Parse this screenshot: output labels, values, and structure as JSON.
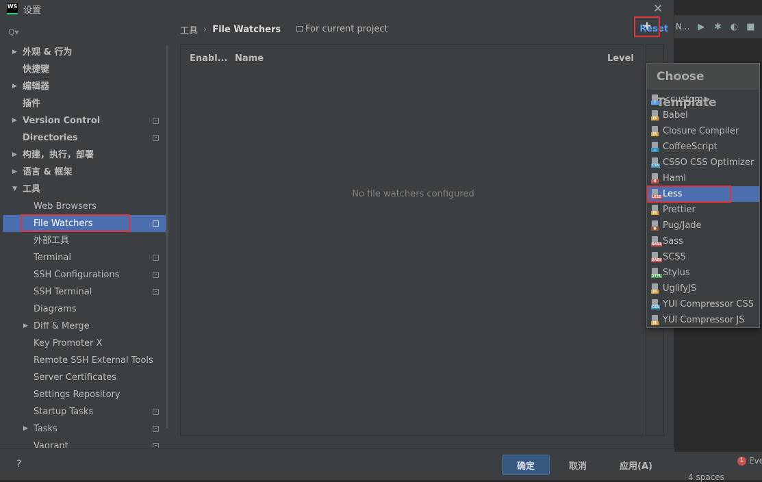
{
  "window": {
    "title": "设置",
    "logo_text": "WS"
  },
  "ide": {
    "toolbar_text": "N...",
    "status_events": "Eve",
    "status_events_count": "1",
    "status_spaces": "4 spaces"
  },
  "sidebar": {
    "search_placeholder": "Q▾",
    "items": [
      {
        "label": "外观 & 行为",
        "arrow": "▶",
        "bold": true,
        "child": false,
        "copy": false
      },
      {
        "label": "快捷键",
        "arrow": "",
        "bold": true,
        "child": false,
        "copy": false
      },
      {
        "label": "编辑器",
        "arrow": "▶",
        "bold": true,
        "child": false,
        "copy": false
      },
      {
        "label": "插件",
        "arrow": "",
        "bold": true,
        "child": false,
        "copy": false
      },
      {
        "label": "Version Control",
        "arrow": "▶",
        "bold": true,
        "child": false,
        "copy": true
      },
      {
        "label": "Directories",
        "arrow": "",
        "bold": true,
        "child": false,
        "copy": true
      },
      {
        "label": "构建，执行，部署",
        "arrow": "▶",
        "bold": true,
        "child": false,
        "copy": false
      },
      {
        "label": "语言 & 框架",
        "arrow": "▶",
        "bold": true,
        "child": false,
        "copy": false
      },
      {
        "label": "工具",
        "arrow": "▼",
        "bold": true,
        "child": false,
        "copy": false
      },
      {
        "label": "Web Browsers",
        "arrow": "",
        "bold": false,
        "child": true,
        "copy": false
      },
      {
        "label": "File Watchers",
        "arrow": "",
        "bold": false,
        "child": true,
        "copy": true,
        "selected": true
      },
      {
        "label": "外部工具",
        "arrow": "",
        "bold": false,
        "child": true,
        "copy": false
      },
      {
        "label": "Terminal",
        "arrow": "",
        "bold": false,
        "child": true,
        "copy": true
      },
      {
        "label": "SSH Configurations",
        "arrow": "",
        "bold": false,
        "child": true,
        "copy": true
      },
      {
        "label": "SSH Terminal",
        "arrow": "",
        "bold": false,
        "child": true,
        "copy": true
      },
      {
        "label": "Diagrams",
        "arrow": "",
        "bold": false,
        "child": true,
        "copy": false
      },
      {
        "label": "Diff & Merge",
        "arrow": "▶",
        "bold": false,
        "child": true,
        "copy": false
      },
      {
        "label": "Key Promoter X",
        "arrow": "",
        "bold": false,
        "child": true,
        "copy": false
      },
      {
        "label": "Remote SSH External Tools",
        "arrow": "",
        "bold": false,
        "child": true,
        "copy": false
      },
      {
        "label": "Server Certificates",
        "arrow": "",
        "bold": false,
        "child": true,
        "copy": false
      },
      {
        "label": "Settings Repository",
        "arrow": "",
        "bold": false,
        "child": true,
        "copy": false
      },
      {
        "label": "Startup Tasks",
        "arrow": "",
        "bold": false,
        "child": true,
        "copy": true
      },
      {
        "label": "Tasks",
        "arrow": "▶",
        "bold": false,
        "child": true,
        "copy": true
      },
      {
        "label": "Vagrant",
        "arrow": "",
        "bold": false,
        "child": true,
        "copy": true
      }
    ]
  },
  "main": {
    "breadcrumb": [
      "工具",
      "File Watchers"
    ],
    "breadcrumb_sep": "›",
    "scope_label": "For current project",
    "reset_label": "Reset",
    "columns": [
      "Enabl...",
      "Name",
      "Level"
    ],
    "empty_text": "No file watchers configured",
    "add_label": "+"
  },
  "popup": {
    "title": "Choose Template",
    "items": [
      {
        "label": "<custom>",
        "tag": "?",
        "tag_color": "#589df6"
      },
      {
        "label": "Babel",
        "tag": "JS",
        "tag_color": "#d9a343"
      },
      {
        "label": "Closure Compiler",
        "tag": "JS",
        "tag_color": "#d9a343"
      },
      {
        "label": "CoffeeScript",
        "tag": "☕",
        "tag_color": "#3592c4"
      },
      {
        "label": "CSSO CSS Optimizer",
        "tag": "CSS",
        "tag_color": "#3592c4"
      },
      {
        "label": "Haml",
        "tag": "H",
        "tag_color": "#c75450"
      },
      {
        "label": "Less",
        "tag": "LESS",
        "tag_color": "#c75450",
        "selected": true
      },
      {
        "label": "Prettier",
        "tag": "JS",
        "tag_color": "#d9a343"
      },
      {
        "label": "Pug/Jade",
        "tag": "●",
        "tag_color": "#a0522d"
      },
      {
        "label": "Sass",
        "tag": "SASS",
        "tag_color": "#c75450"
      },
      {
        "label": "SCSS",
        "tag": "SASS",
        "tag_color": "#c75450"
      },
      {
        "label": "Stylus",
        "tag": "STYL",
        "tag_color": "#499c54"
      },
      {
        "label": "UglifyJS",
        "tag": "JS",
        "tag_color": "#d9a343"
      },
      {
        "label": "YUI Compressor CSS",
        "tag": "CSS",
        "tag_color": "#3592c4"
      },
      {
        "label": "YUI Compressor JS",
        "tag": "JS",
        "tag_color": "#d9a343"
      }
    ]
  },
  "footer": {
    "help_label": "?",
    "ok_label": "确定",
    "cancel_label": "取消",
    "apply_label": "应用(A)"
  },
  "colors": {
    "selection": "#4b6eaf",
    "highlight_box": "#e0353d",
    "link": "#589df6",
    "ok_button": "#365880"
  }
}
